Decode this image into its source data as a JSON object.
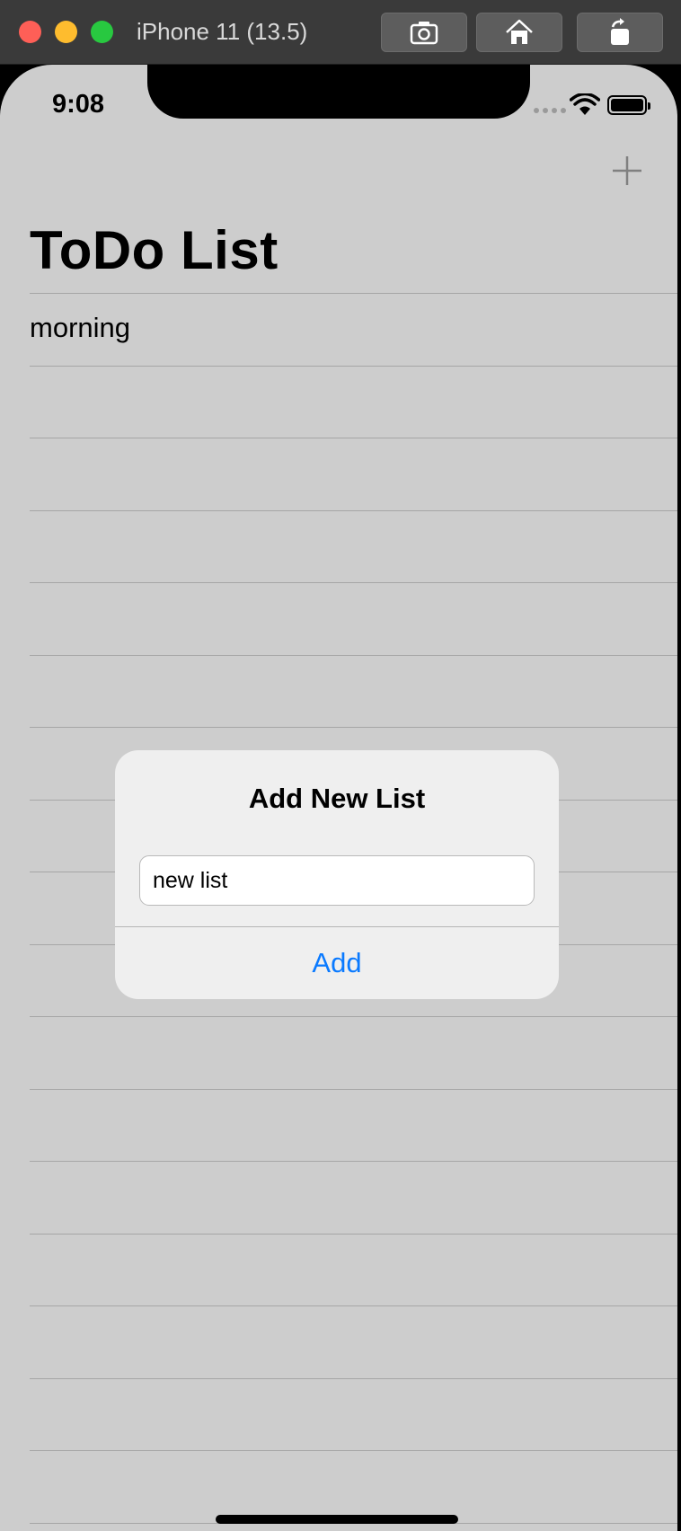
{
  "window": {
    "title": "iPhone 11 (13.5)",
    "toolbar": {
      "screenshot_icon": "camera-icon",
      "home_icon": "home-icon",
      "rotate_icon": "rotate-icon"
    }
  },
  "status_bar": {
    "time": "9:08"
  },
  "nav": {
    "title": "ToDo List",
    "add_icon": "plus-icon"
  },
  "list": {
    "items": [
      {
        "label": "morning"
      },
      {
        "label": ""
      },
      {
        "label": ""
      },
      {
        "label": ""
      },
      {
        "label": ""
      },
      {
        "label": ""
      },
      {
        "label": ""
      },
      {
        "label": ""
      },
      {
        "label": ""
      },
      {
        "label": ""
      },
      {
        "label": ""
      },
      {
        "label": ""
      },
      {
        "label": ""
      },
      {
        "label": ""
      },
      {
        "label": ""
      },
      {
        "label": ""
      },
      {
        "label": ""
      },
      {
        "label": ""
      }
    ]
  },
  "alert": {
    "title": "Add New List",
    "input_value": "new list",
    "action_label": "Add"
  },
  "colors": {
    "accent": "#0a7aff",
    "background": "#cdcdcd"
  }
}
